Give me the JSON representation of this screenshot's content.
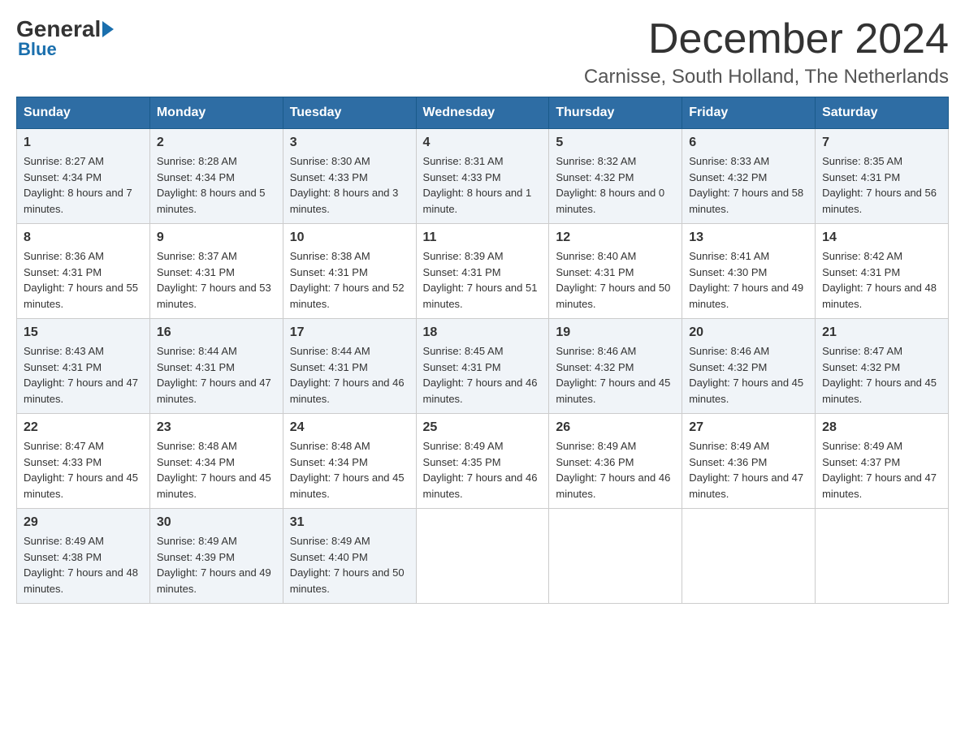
{
  "header": {
    "logo_general": "General",
    "logo_blue": "Blue",
    "month_title": "December 2024",
    "location": "Carnisse, South Holland, The Netherlands"
  },
  "days_of_week": [
    "Sunday",
    "Monday",
    "Tuesday",
    "Wednesday",
    "Thursday",
    "Friday",
    "Saturday"
  ],
  "weeks": [
    [
      {
        "day": "1",
        "sunrise": "8:27 AM",
        "sunset": "4:34 PM",
        "daylight": "8 hours and 7 minutes."
      },
      {
        "day": "2",
        "sunrise": "8:28 AM",
        "sunset": "4:34 PM",
        "daylight": "8 hours and 5 minutes."
      },
      {
        "day": "3",
        "sunrise": "8:30 AM",
        "sunset": "4:33 PM",
        "daylight": "8 hours and 3 minutes."
      },
      {
        "day": "4",
        "sunrise": "8:31 AM",
        "sunset": "4:33 PM",
        "daylight": "8 hours and 1 minute."
      },
      {
        "day": "5",
        "sunrise": "8:32 AM",
        "sunset": "4:32 PM",
        "daylight": "8 hours and 0 minutes."
      },
      {
        "day": "6",
        "sunrise": "8:33 AM",
        "sunset": "4:32 PM",
        "daylight": "7 hours and 58 minutes."
      },
      {
        "day": "7",
        "sunrise": "8:35 AM",
        "sunset": "4:31 PM",
        "daylight": "7 hours and 56 minutes."
      }
    ],
    [
      {
        "day": "8",
        "sunrise": "8:36 AM",
        "sunset": "4:31 PM",
        "daylight": "7 hours and 55 minutes."
      },
      {
        "day": "9",
        "sunrise": "8:37 AM",
        "sunset": "4:31 PM",
        "daylight": "7 hours and 53 minutes."
      },
      {
        "day": "10",
        "sunrise": "8:38 AM",
        "sunset": "4:31 PM",
        "daylight": "7 hours and 52 minutes."
      },
      {
        "day": "11",
        "sunrise": "8:39 AM",
        "sunset": "4:31 PM",
        "daylight": "7 hours and 51 minutes."
      },
      {
        "day": "12",
        "sunrise": "8:40 AM",
        "sunset": "4:31 PM",
        "daylight": "7 hours and 50 minutes."
      },
      {
        "day": "13",
        "sunrise": "8:41 AM",
        "sunset": "4:30 PM",
        "daylight": "7 hours and 49 minutes."
      },
      {
        "day": "14",
        "sunrise": "8:42 AM",
        "sunset": "4:31 PM",
        "daylight": "7 hours and 48 minutes."
      }
    ],
    [
      {
        "day": "15",
        "sunrise": "8:43 AM",
        "sunset": "4:31 PM",
        "daylight": "7 hours and 47 minutes."
      },
      {
        "day": "16",
        "sunrise": "8:44 AM",
        "sunset": "4:31 PM",
        "daylight": "7 hours and 47 minutes."
      },
      {
        "day": "17",
        "sunrise": "8:44 AM",
        "sunset": "4:31 PM",
        "daylight": "7 hours and 46 minutes."
      },
      {
        "day": "18",
        "sunrise": "8:45 AM",
        "sunset": "4:31 PM",
        "daylight": "7 hours and 46 minutes."
      },
      {
        "day": "19",
        "sunrise": "8:46 AM",
        "sunset": "4:32 PM",
        "daylight": "7 hours and 45 minutes."
      },
      {
        "day": "20",
        "sunrise": "8:46 AM",
        "sunset": "4:32 PM",
        "daylight": "7 hours and 45 minutes."
      },
      {
        "day": "21",
        "sunrise": "8:47 AM",
        "sunset": "4:32 PM",
        "daylight": "7 hours and 45 minutes."
      }
    ],
    [
      {
        "day": "22",
        "sunrise": "8:47 AM",
        "sunset": "4:33 PM",
        "daylight": "7 hours and 45 minutes."
      },
      {
        "day": "23",
        "sunrise": "8:48 AM",
        "sunset": "4:34 PM",
        "daylight": "7 hours and 45 minutes."
      },
      {
        "day": "24",
        "sunrise": "8:48 AM",
        "sunset": "4:34 PM",
        "daylight": "7 hours and 45 minutes."
      },
      {
        "day": "25",
        "sunrise": "8:49 AM",
        "sunset": "4:35 PM",
        "daylight": "7 hours and 46 minutes."
      },
      {
        "day": "26",
        "sunrise": "8:49 AM",
        "sunset": "4:36 PM",
        "daylight": "7 hours and 46 minutes."
      },
      {
        "day": "27",
        "sunrise": "8:49 AM",
        "sunset": "4:36 PM",
        "daylight": "7 hours and 47 minutes."
      },
      {
        "day": "28",
        "sunrise": "8:49 AM",
        "sunset": "4:37 PM",
        "daylight": "7 hours and 47 minutes."
      }
    ],
    [
      {
        "day": "29",
        "sunrise": "8:49 AM",
        "sunset": "4:38 PM",
        "daylight": "7 hours and 48 minutes."
      },
      {
        "day": "30",
        "sunrise": "8:49 AM",
        "sunset": "4:39 PM",
        "daylight": "7 hours and 49 minutes."
      },
      {
        "day": "31",
        "sunrise": "8:49 AM",
        "sunset": "4:40 PM",
        "daylight": "7 hours and 50 minutes."
      },
      null,
      null,
      null,
      null
    ]
  ],
  "labels": {
    "sunrise": "Sunrise:",
    "sunset": "Sunset:",
    "daylight": "Daylight:"
  }
}
